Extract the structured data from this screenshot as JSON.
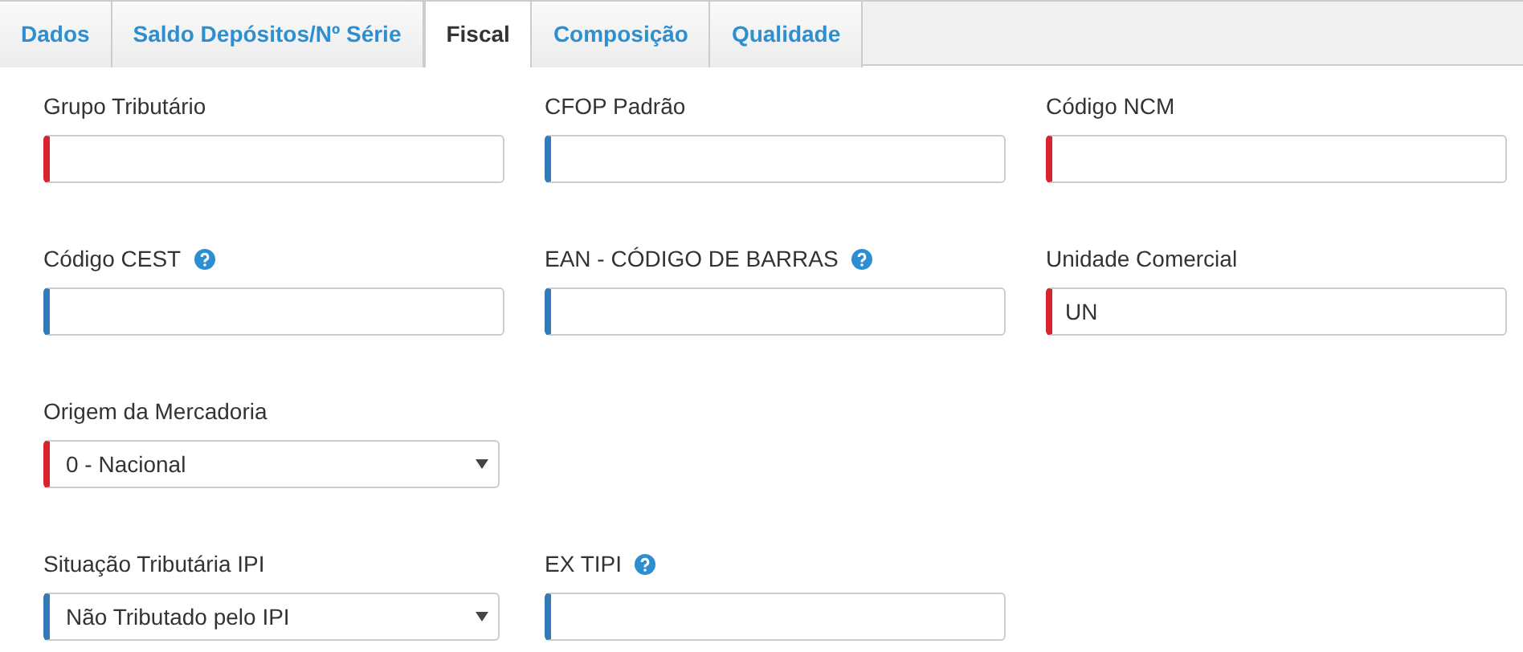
{
  "tabs": [
    {
      "label": "Dados",
      "selected": false
    },
    {
      "label": "Saldo Depósitos/Nº Série",
      "selected": false
    },
    {
      "label": "Fiscal",
      "selected": true
    },
    {
      "label": "Composição",
      "selected": false
    },
    {
      "label": "Qualidade",
      "selected": false
    }
  ],
  "rows": [
    {
      "fields": [
        {
          "kind": "text",
          "label": "Grupo Tributário",
          "required": true,
          "help": false
        },
        {
          "kind": "text",
          "label": "CFOP Padrão",
          "required": false,
          "help": false
        },
        {
          "kind": "text",
          "label": "Código NCM",
          "required": true,
          "help": false
        }
      ]
    },
    {
      "fields": [
        {
          "kind": "text",
          "label": "Código CEST",
          "required": false,
          "help": true
        },
        {
          "kind": "text",
          "label": "EAN - CÓDIGO DE BARRAS",
          "required": false,
          "help": true
        },
        {
          "kind": "text",
          "label": "Unidade Comercial",
          "required": true,
          "help": false,
          "value": "UN"
        }
      ]
    },
    {
      "fields": [
        {
          "kind": "select",
          "label": "Origem da Mercadoria",
          "required": true,
          "help": false,
          "value": "0 - Nacional"
        }
      ]
    },
    {
      "fields": [
        {
          "kind": "select",
          "label": "Situação Tributária IPI",
          "required": false,
          "help": false,
          "value": "Não Tributado pelo IPI"
        },
        {
          "kind": "text",
          "label": "EX TIPI",
          "required": false,
          "help": true
        }
      ]
    }
  ]
}
